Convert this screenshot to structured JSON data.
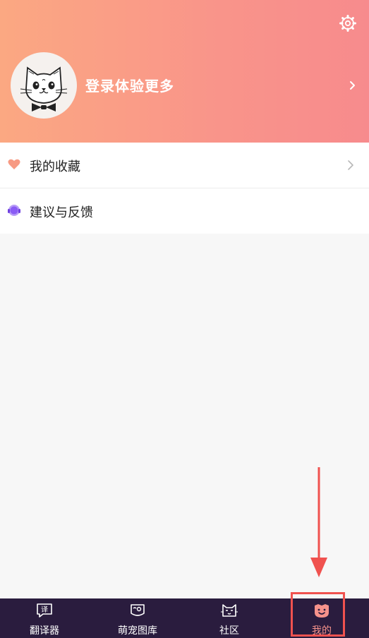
{
  "header": {
    "login_text": "登录体验更多",
    "background_colors": [
      "#fba882",
      "#f78b8d"
    ]
  },
  "menu": {
    "items": [
      {
        "label": "我的收藏",
        "icon": "heart-icon",
        "icon_color": "#f79a83",
        "has_chevron": true
      },
      {
        "label": "建议与反馈",
        "icon": "headset-icon",
        "icon_color": "#8a5cf5",
        "has_chevron": false
      }
    ]
  },
  "tabbar": {
    "background": "#2a1c3e",
    "active_color": "#f6928b",
    "tabs": [
      {
        "label": "翻译器",
        "icon": "translate-speech-icon",
        "active": false
      },
      {
        "label": "萌宠图库",
        "icon": "pet-gallery-icon",
        "active": false
      },
      {
        "label": "社区",
        "icon": "cat-face-icon",
        "active": false
      },
      {
        "label": "我的",
        "icon": "smile-face-icon",
        "active": true
      }
    ]
  },
  "annotation": {
    "highlight_color": "#f0524f",
    "target": "我的"
  }
}
